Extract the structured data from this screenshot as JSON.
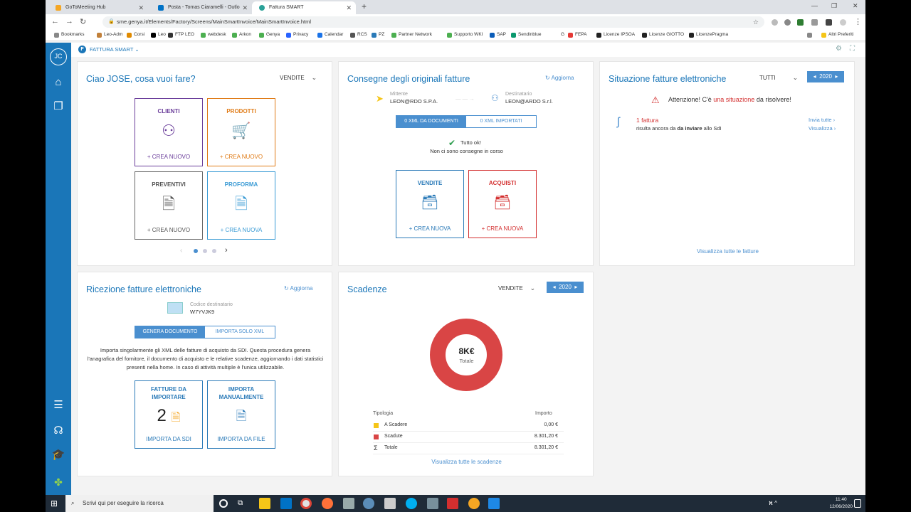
{
  "browser": {
    "tabs": [
      {
        "label": "GoToMeeting Hub",
        "color": "#f5a623"
      },
      {
        "label": "Posta - Tomas Ciaramelli - Outlo",
        "color": "#0072c6"
      },
      {
        "label": "Fattura SMART",
        "color": "#2aa198"
      }
    ],
    "url": "sme.genya.it/Elements/Factory/Screens/MainSmartInvoice/MainSmartInvoice.html",
    "bookmarks": [
      {
        "label": "Bookmarks",
        "color": "#888888"
      },
      {
        "label": "Leo-Adm",
        "color": "#c1803a"
      },
      {
        "label": "Corsi",
        "color": "#e08a00"
      },
      {
        "label": "Leo",
        "color": "#000000"
      },
      {
        "label": "FTP LEO",
        "color": "#333333"
      },
      {
        "label": "webdesk",
        "color": "#4caf50"
      },
      {
        "label": "Arkon",
        "color": "#4caf50"
      },
      {
        "label": "Genya",
        "color": "#4caf50"
      },
      {
        "label": "Privacy",
        "color": "#2962ff"
      },
      {
        "label": "Calendar",
        "color": "#1a73e8"
      },
      {
        "label": "RCS",
        "color": "#555555"
      },
      {
        "label": "PZ",
        "color": "#2a7ab8"
      },
      {
        "label": "Partner Network",
        "color": "#4caf50"
      },
      {
        "label": "Supporto WKI",
        "color": "#4caf50"
      },
      {
        "label": "SAP",
        "color": "#0a5cb8"
      },
      {
        "label": "Sendinblue",
        "color": "#0b996e"
      },
      {
        "label": "G",
        "color": "#ffffff"
      },
      {
        "label": "FEPA",
        "color": "#e53935"
      },
      {
        "label": "Licenze IPSOA",
        "color": "#222222"
      },
      {
        "label": "Licenze GIOTTO",
        "color": "#222222"
      },
      {
        "label": "LicenzePragma",
        "color": "#222222"
      }
    ],
    "other_bookmarks": "Altri Preferiti"
  },
  "app": {
    "avatar": "JC",
    "name": "FATTURA SMART",
    "accent": "#1a76b8"
  },
  "home": {
    "title": "Ciao JOSE, cosa vuoi fare?",
    "filter": "VENDITE",
    "tiles": [
      {
        "label": "CLIENTI",
        "cta": "+ CREA NUOVO",
        "color": "#6a3d9a",
        "icon": "person-icon"
      },
      {
        "label": "PRODOTTI",
        "cta": "+ CREA NUOVO",
        "color": "#e07b16",
        "icon": "cart-icon"
      },
      {
        "label": "PREVENTIVI",
        "cta": "+ CREA NUOVO",
        "color": "#555555",
        "icon": "document-icon"
      },
      {
        "label": "PROFORMA",
        "cta": "+ CREA NUOVA",
        "color": "#3a9bd5",
        "icon": "document-icon"
      }
    ],
    "pager": {
      "pages": 3,
      "current": 1
    }
  },
  "consegne": {
    "title": "Consegne degli originali fatture",
    "refresh": "Aggiorna",
    "mittente_label": "Mittente",
    "mittente": "LEON@RDO S.P.A.",
    "destinatario_label": "Destinatario",
    "destinatario": "LEON@ARDO S.r.l.",
    "toggle": [
      "0   XML DA DOCUMENTI",
      "0   XML IMPORTATI"
    ],
    "status": "Tutto ok!",
    "status_sub": "Non ci sono consegne in corso",
    "tiles": [
      {
        "label": "VENDITE",
        "cta": "+ CREA NUOVA",
        "color": "#2a7ab8"
      },
      {
        "label": "ACQUISTI",
        "cta": "+ CREA NUOVA",
        "color": "#d32f2f"
      }
    ]
  },
  "situazione": {
    "title": "Situazione fatture elettroniche",
    "filter": "TUTTI",
    "year": "2020",
    "alert_prefix": "Attenzione! C'è ",
    "alert_strong": "una situazione",
    "alert_suffix": " da risolvere!",
    "item_count": "1 fattura",
    "item_text_a": "risulta ancora da ",
    "item_text_b": "da inviare",
    "item_text_c": " allo SdI",
    "send_all": "Invia tutte",
    "view": "Visualizza",
    "view_all": "Visualizza tutte le fatture"
  },
  "ricezione": {
    "title": "Ricezione fatture elettroniche",
    "refresh": "Aggiorna",
    "code_label": "Codice destinatario",
    "code": "W7YVJK9",
    "toggle": [
      "GENERA DOCUMENTO",
      "IMPORTA SOLO XML"
    ],
    "description": "Importa singolarmente gli XML delle fatture di acquisto da SDI. Questa procedura genera l'anagrafica del fornitore, il documento di acquisto e le relative scadenze, aggiornando i dati statistici presenti nella home. In caso di attività multiple è l'unica utilizzabile.",
    "tile1_label": "FATTURE DA IMPORTARE",
    "tile1_count": "2",
    "tile1_cta": "IMPORTA DA SDI",
    "tile2_label": "IMPORTA MANUALMENTE",
    "tile2_cta": "IMPORTA DA FILE"
  },
  "scadenze": {
    "title": "Scadenze",
    "filter": "VENDITE",
    "year": "2020",
    "total_value": "8K€",
    "total_label": "Totale",
    "col_type": "Tipologia",
    "col_amount": "Importo",
    "rows": [
      {
        "label": "A Scadere",
        "amount": "0,00 €",
        "color": "#f5c518"
      },
      {
        "label": "Scadute",
        "amount": "8.301,20 €",
        "color": "#d94545"
      },
      {
        "label": "Totale",
        "amount": "8.301,20 €",
        "color": "#333333"
      }
    ],
    "view_all": "Visualizza tutte le scadenze",
    "chart_data": {
      "type": "pie",
      "categories": [
        "A Scadere",
        "Scadute"
      ],
      "values": [
        0.0,
        8301.2
      ]
    }
  },
  "taskbar": {
    "search_placeholder": "Scrivi qui per eseguire la ricerca",
    "time": "11:40",
    "date": "12/06/2020"
  }
}
